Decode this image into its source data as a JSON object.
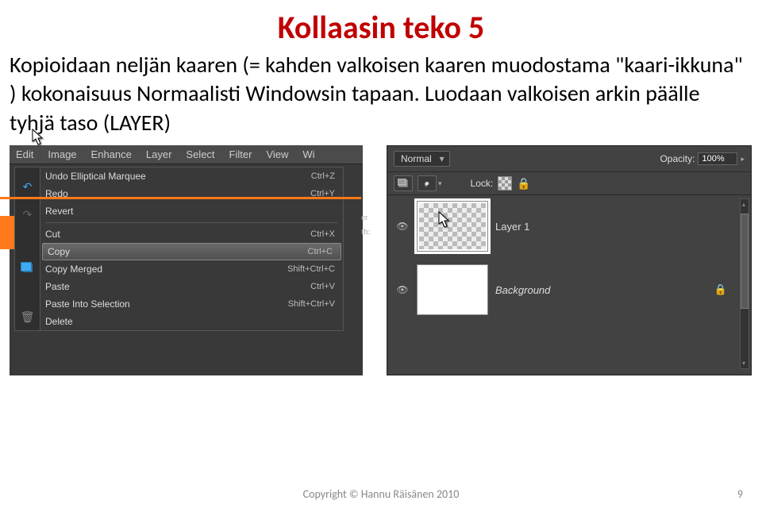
{
  "title": "Kollaasin teko 5",
  "body_text": "Kopioidaan neljän kaaren (= kahden valkoisen kaaren muodostama \"kaari-ikkuna\" ) kokonaisuus Normaalisti Windowsin tapaan. Luodaan valkoisen arkin päälle tyhjä taso (LAYER)",
  "menubar": [
    "Edit",
    "Image",
    "Enhance",
    "Layer",
    "Select",
    "Filter",
    "View",
    "Wi"
  ],
  "side_labels": [
    "er",
    "th:"
  ],
  "edit_menu": {
    "items": [
      {
        "label": "Undo Elliptical Marquee",
        "shortcut": "Ctrl+Z",
        "divider_after": false
      },
      {
        "label": "Redo",
        "shortcut": "Ctrl+Y",
        "divider_after": false
      },
      {
        "label": "Revert",
        "shortcut": "",
        "divider_after": true
      },
      {
        "label": "Cut",
        "shortcut": "Ctrl+X",
        "divider_after": false
      },
      {
        "label": "Copy",
        "shortcut": "Ctrl+C",
        "divider_after": false,
        "highlight": true
      },
      {
        "label": "Copy Merged",
        "shortcut": "Shift+Ctrl+C",
        "divider_after": false
      },
      {
        "label": "Paste",
        "shortcut": "Ctrl+V",
        "divider_after": false
      },
      {
        "label": "Paste Into Selection",
        "shortcut": "Shift+Ctrl+V",
        "divider_after": false
      },
      {
        "label": "Delete",
        "shortcut": "",
        "divider_after": false
      }
    ]
  },
  "layers": {
    "mode": "Normal",
    "opacity_label": "Opacity:",
    "opacity_value": "100%",
    "lock_label": "Lock:",
    "rows": [
      {
        "name": "Layer 1",
        "active": true,
        "checker": true,
        "italic": false
      },
      {
        "name": "Background",
        "active": false,
        "checker": false,
        "italic": true,
        "locked": true
      }
    ]
  },
  "footer": "Copyright © Hannu Räisänen 2010",
  "page_num": "9"
}
